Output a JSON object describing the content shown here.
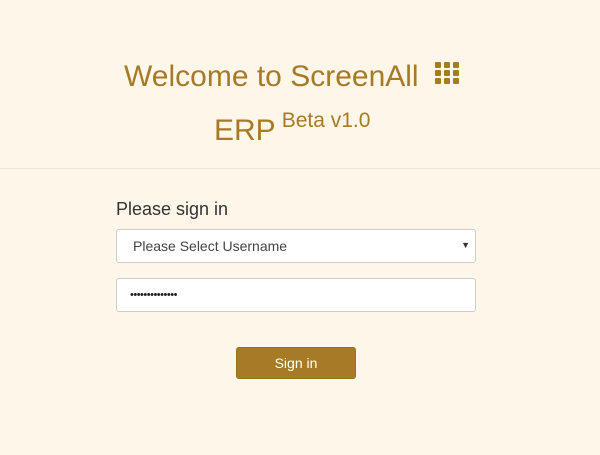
{
  "header": {
    "title_line1": "Welcome to ScreenAll",
    "title_icon": "grid-icon",
    "title_line2": "ERP",
    "version_label": "Beta v1.0"
  },
  "form": {
    "heading": "Please sign in",
    "username_select": {
      "selected": "Please Select Username",
      "icon": "chevron-down-icon"
    },
    "password": {
      "masked_value": "••••••••••••••"
    },
    "submit_label": "Sign in"
  },
  "colors": {
    "background": "#fdf6e9",
    "accent": "#a77a26",
    "text": "#333333"
  }
}
